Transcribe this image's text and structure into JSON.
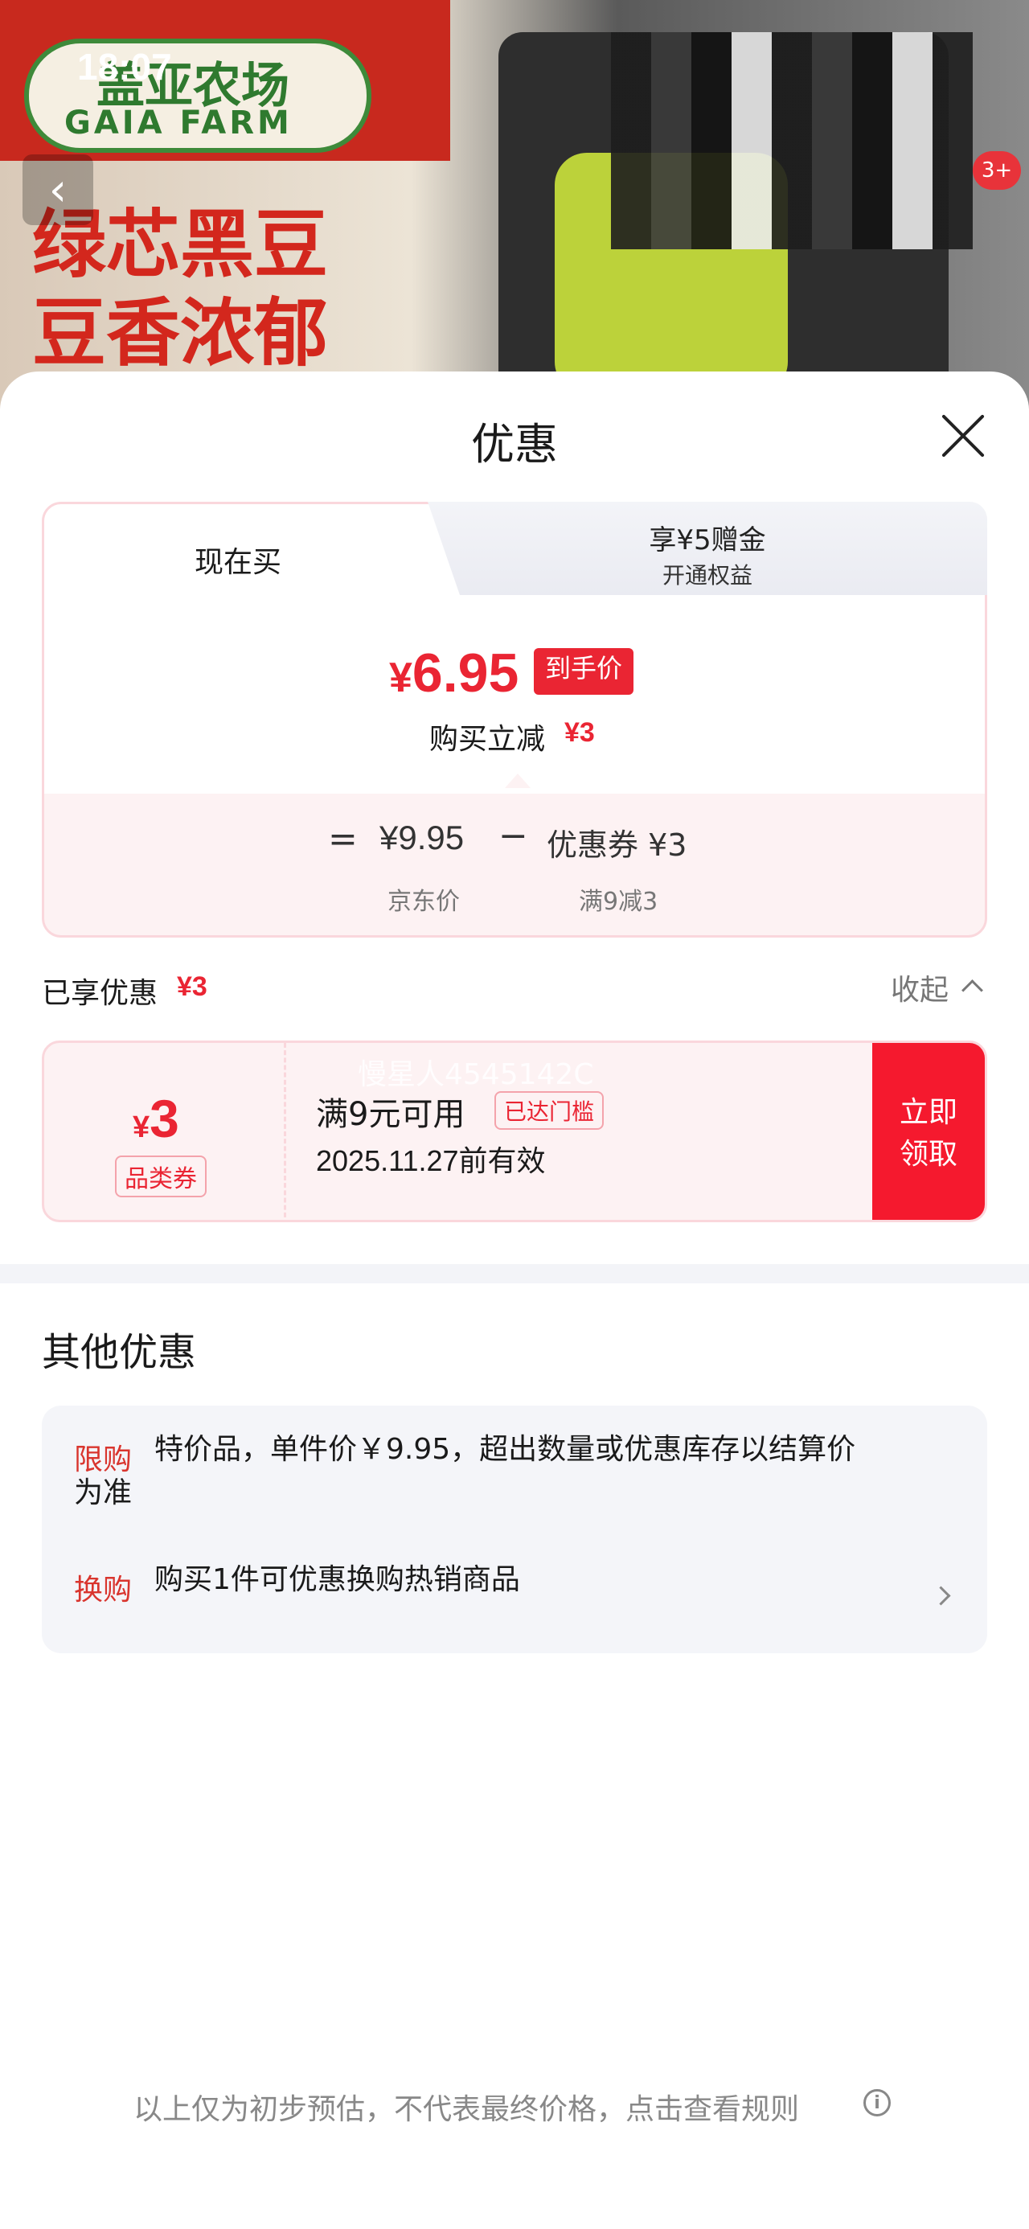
{
  "status_bar": {
    "time": "18:07"
  },
  "background": {
    "brand_cn": "盖亚农场",
    "brand_en": "GAIA FARM",
    "slogan_line1": "绿芯黑豆",
    "slogan_line2": "豆香浓郁",
    "badge": "3+"
  },
  "sheet": {
    "title": "优惠",
    "tabs": [
      {
        "label": "现在买"
      },
      {
        "label": "享¥5赠金",
        "sublabel": "开通权益"
      }
    ],
    "price": {
      "currency": "¥",
      "final": "6.95",
      "final_tag": "到手价",
      "instant_label": "购买立减",
      "instant_amount": "¥3",
      "equals": "=",
      "jd_price": "¥9.95",
      "minus": "−",
      "coupon_value": "优惠券 ¥3",
      "jd_label": "京东价",
      "coupon_rule": "满9减3"
    },
    "enjoyed": {
      "label": "已享优惠",
      "amount": "¥3",
      "collapse": "收起"
    },
    "coupon": {
      "currency": "¥",
      "amount": "3",
      "type": "品类券",
      "condition": "满9元可用",
      "reached": "已达门槛",
      "expiry": "2025.11.27前有效",
      "watermark": "慢星人4545142C",
      "claim_line1": "立即",
      "claim_line2": "领取"
    },
    "other": {
      "title": "其他优惠",
      "items": [
        {
          "tag": "限购",
          "text_line1": "特价品，单件价￥9.95，超出数量或优惠库存以结算价",
          "text_line2": "为准"
        },
        {
          "tag": "换购",
          "text_line1": "购买1件可优惠换购热销商品"
        }
      ]
    },
    "disclaimer": "以上仅为初步预估，不代表最终价格，点击查看规则"
  }
}
